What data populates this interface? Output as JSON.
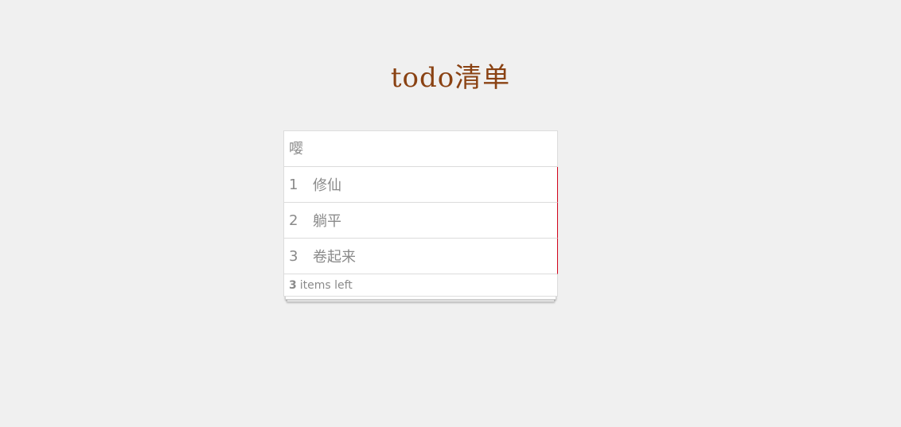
{
  "app": {
    "title": "todo清单"
  },
  "input": {
    "value": "",
    "placeholder": "嘤"
  },
  "todos": [
    {
      "index": "1",
      "text": "修仙"
    },
    {
      "index": "2",
      "text": "躺平"
    },
    {
      "index": "3",
      "text": "卷起来"
    }
  ],
  "footer": {
    "count": "3",
    "label": "items left"
  },
  "colors": {
    "title": "#8a4213",
    "accent_border": "#d0021b",
    "background": "#f0f0f0"
  }
}
